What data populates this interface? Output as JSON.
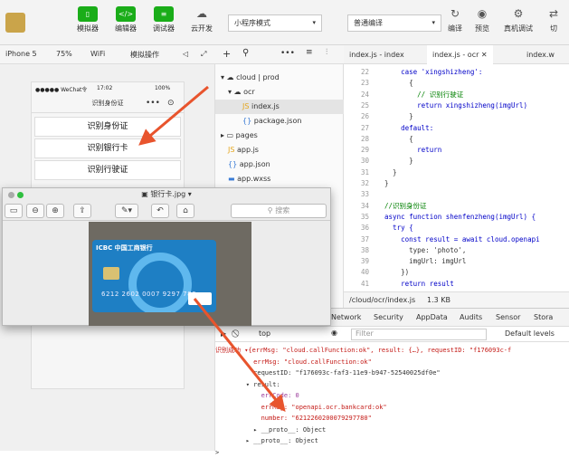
{
  "toolbar": {
    "buttons": [
      {
        "icon": "phone-icon",
        "label": "模拟器"
      },
      {
        "icon": "code-icon",
        "label": "编辑器"
      },
      {
        "icon": "debug-icon",
        "label": "调试器"
      },
      {
        "icon": "cloud-icon",
        "label": "云开发"
      }
    ],
    "mode_select": "小程序模式",
    "compile_select": "普通编译",
    "compile": "编译",
    "preview": "预览",
    "real_debug": "真机调试",
    "cut": "切"
  },
  "sim": {
    "device": "iPhone 5",
    "zoom": "75%",
    "network": "WiFi",
    "ops": "模拟操作",
    "carrier": "●●●●● WeChat令",
    "time": "17:02",
    "battery": "100%",
    "title": "识别身份证",
    "buttons": [
      "识别身份证",
      "识别银行卡",
      "识别行驶证"
    ]
  },
  "tree": {
    "items": [
      "cloud | prod",
      "ocr",
      "index.js",
      "package.json",
      "pages",
      "app.js",
      "app.json",
      "app.wxss"
    ]
  },
  "editor": {
    "tabs": [
      "index.js - index",
      "index.js - ocr",
      "index.w"
    ],
    "lines": [
      {
        "n": "22",
        "t": "      case 'xingshizheng':"
      },
      {
        "n": "23",
        "t": "        {"
      },
      {
        "n": "24",
        "t": "          // 识别行驶证"
      },
      {
        "n": "25",
        "t": "          return xingshizheng(imgUrl)"
      },
      {
        "n": "26",
        "t": "        }"
      },
      {
        "n": "27",
        "t": "      default:"
      },
      {
        "n": "28",
        "t": "        {"
      },
      {
        "n": "29",
        "t": "          return"
      },
      {
        "n": "30",
        "t": "        }"
      },
      {
        "n": "31",
        "t": "    }"
      },
      {
        "n": "32",
        "t": "  }"
      },
      {
        "n": "33",
        "t": ""
      },
      {
        "n": "34",
        "t": "  //识别身份证"
      },
      {
        "n": "35",
        "t": "  async function shenfenzheng(imgUrl) {"
      },
      {
        "n": "36",
        "t": "    try {"
      },
      {
        "n": "37",
        "t": "      const result = await cloud.openapi"
      },
      {
        "n": "38",
        "t": "        type: 'photo',"
      },
      {
        "n": "39",
        "t": "        imgUrl: imgUrl"
      },
      {
        "n": "40",
        "t": "      })"
      },
      {
        "n": "41",
        "t": "      return result"
      }
    ],
    "path": "/cloud/ocr/index.js",
    "size": "1.3 KB"
  },
  "devtools": {
    "tabs": [
      "Network",
      "Security",
      "AppData",
      "Audits",
      "Sensor",
      "Stora"
    ],
    "context": "top",
    "filter": "Filter",
    "levels": "Default levels",
    "lines": [
      "识别成功 ▾{errMsg: \"cloud.callFunction:ok\", result: {…}, requestID: \"f176093c-f",
      "          errMsg: \"cloud.callFunction:ok\"",
      "          requestID: \"f176093c-faf3-11e9-b947-52540025df0e\"",
      "        ▾ result:",
      "            errCode: 0",
      "            errMsg: \"openapi.ocr.bankcard:ok\"",
      "            number: \"6212260200079297780\"",
      "          ▸ __proto__: Object",
      "        ▸ __proto__: Object",
      ">"
    ]
  },
  "viewer": {
    "title": "银行卡.jpg",
    "search": "搜索",
    "bank": "ICBC 中国工商银行",
    "card_number": "6212 2602 0007 9297 780"
  },
  "colors": {
    "green": "#1aad19",
    "arrow": "#e8542d"
  }
}
